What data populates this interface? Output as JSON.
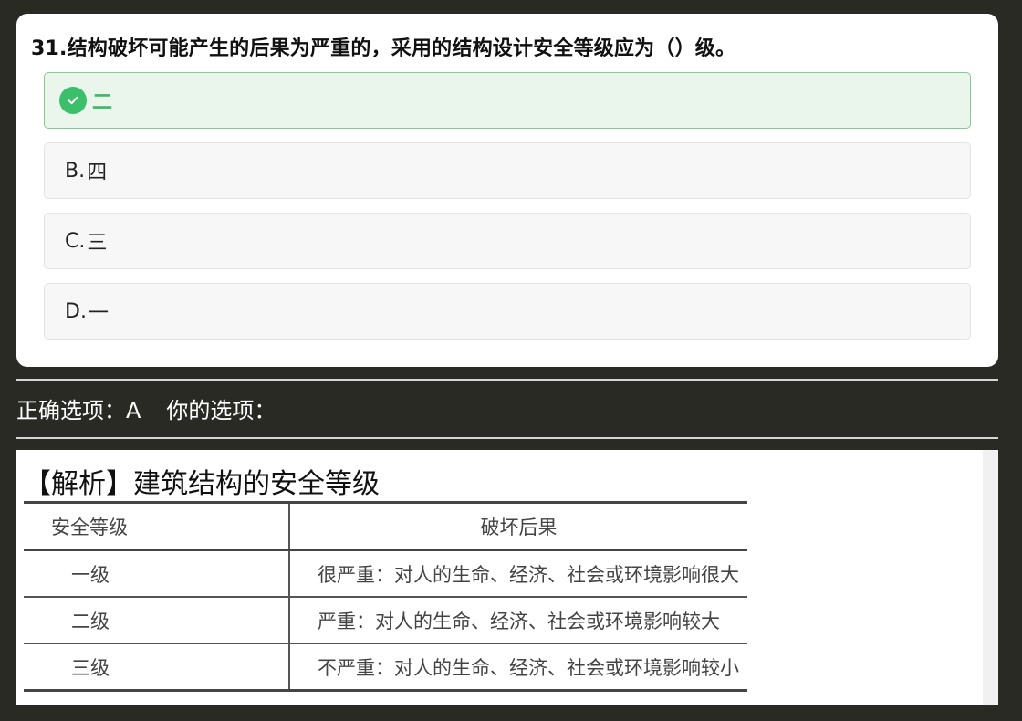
{
  "question": {
    "title": "31.结构破坏可能产生的后果为严重的，采用的结构设计安全等级应为（）级。",
    "options": [
      {
        "letter": "",
        "text": "二",
        "state": "correct"
      },
      {
        "letter": "B.",
        "text": "四",
        "state": "normal"
      },
      {
        "letter": "C.",
        "text": "三",
        "state": "normal"
      },
      {
        "letter": "D.",
        "text": "一",
        "state": "normal"
      }
    ]
  },
  "answer": {
    "correct_label": "正确选项：",
    "correct_value": "A",
    "yours_label": "你的选项："
  },
  "analysis": {
    "title": "【解析】建筑结构的安全等级",
    "table": {
      "headers": [
        "安全等级",
        "破坏后果"
      ],
      "rows": [
        [
          "一级",
          "很严重：对人的生命、经济、社会或环境影响很大"
        ],
        [
          "二级",
          "严重：对人的生命、经济、社会或环境影响较大"
        ],
        [
          "三级",
          "不严重：对人的生命、经济、社会或环境影响较小"
        ]
      ]
    }
  },
  "colors": {
    "background": "#2a2a25",
    "correct_green": "#3bbf6a",
    "correct_bg": "#eaf6ec"
  },
  "icons": {
    "correct_marker": "check-circle-icon"
  }
}
